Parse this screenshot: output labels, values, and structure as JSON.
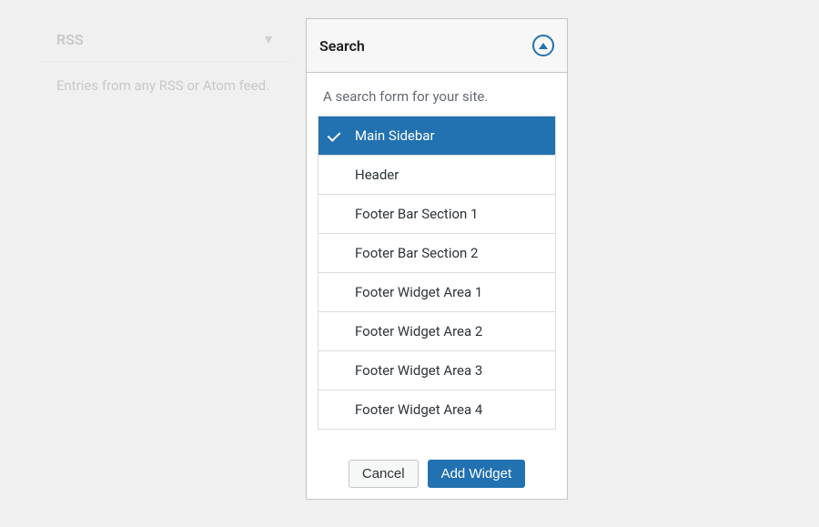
{
  "leftWidget": {
    "title": "RSS",
    "description": "Entries from any RSS or Atom feed."
  },
  "rightWidget": {
    "title": "Search",
    "description": "A search form for your site."
  },
  "sidebarAreas": [
    {
      "label": "Main Sidebar",
      "selected": true
    },
    {
      "label": "Header",
      "selected": false
    },
    {
      "label": "Footer Bar Section 1",
      "selected": false
    },
    {
      "label": "Footer Bar Section 2",
      "selected": false
    },
    {
      "label": "Footer Widget Area 1",
      "selected": false
    },
    {
      "label": "Footer Widget Area 2",
      "selected": false
    },
    {
      "label": "Footer Widget Area 3",
      "selected": false
    },
    {
      "label": "Footer Widget Area 4",
      "selected": false
    }
  ],
  "buttons": {
    "cancel": "Cancel",
    "addWidget": "Add Widget"
  }
}
